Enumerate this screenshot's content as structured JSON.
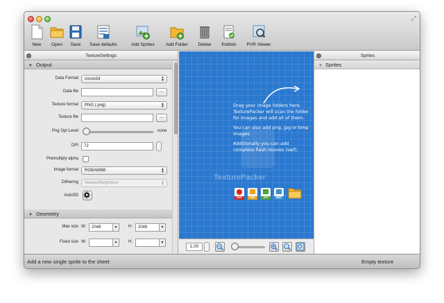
{
  "toolbar": {
    "new": "New",
    "open": "Open",
    "save": "Save",
    "save_defaults": "Save defaults",
    "add_sprites": "Add Sprites",
    "add_folder": "Add Folder",
    "delete": "Delete",
    "publish": "Publish",
    "pvr_viewer": "PVR Viewer"
  },
  "settings_panel": {
    "title": "TextureSettings",
    "output_section": "Output",
    "geometry_section": "Geometry",
    "fields": {
      "data_format_label": "Data Format",
      "data_format_value": "cocos2d",
      "data_file_label": "Data file",
      "data_file_value": "",
      "texture_format_label": "Texture format",
      "texture_format_value": "PNG (.png)",
      "texture_file_label": "Texture file",
      "texture_file_value": "",
      "browse": "...",
      "png_opt_label": "Png Opt Level",
      "png_opt_value": "none",
      "dpi_label": "DPI",
      "dpi_value": "72",
      "premultiply_label": "Premultiply alpha",
      "image_format_label": "Image format",
      "image_format_value": "RGBA8888",
      "dithering_label": "Dithering",
      "dithering_value": "NearestNeighbour",
      "autosd_label": "AutoSD",
      "max_size_label": "Max size",
      "max_w_label": "W:",
      "max_w_value": "2048",
      "max_h_label": "H:",
      "max_h_value": "2048",
      "fixed_size_label": "Fixed size",
      "fixed_w_label": "W:",
      "fixed_w_value": "",
      "fixed_h_label": "H:",
      "fixed_h_value": ""
    }
  },
  "canvas": {
    "help_1": "Drag your image folders here. TexturePacker will scan the folder for images and add all of them.",
    "help_2": "You can also add png, jpg or bmp images.",
    "help_3": "Additionally you can add complete flash movies (swf).",
    "watermark": "TexturePacker",
    "file_types": [
      "SWF",
      "PNG",
      "JPG",
      "BMP"
    ],
    "zoom_value": "1,00"
  },
  "sprites_panel": {
    "title": "Sprites",
    "root": "Sprites"
  },
  "statusbar": {
    "hint": "Add a new single sprite to the sheet",
    "status": "Empty texture"
  },
  "colors": {
    "canvas_blue": "#2a78cf",
    "swf": "#d9261c",
    "png": "#e8a21a",
    "jpg": "#4aa23a",
    "bmp": "#3a8ed1"
  }
}
